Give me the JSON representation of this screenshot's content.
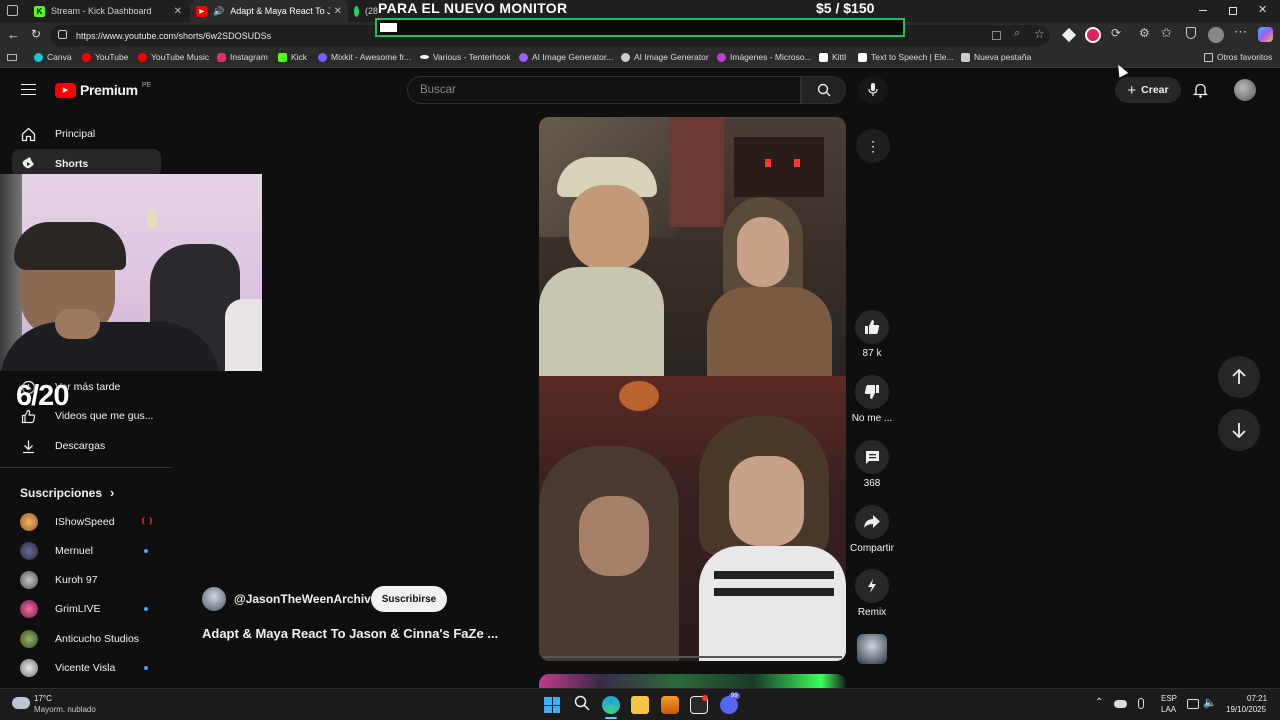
{
  "browser": {
    "tabs": [
      {
        "label": "Stream - Kick Dashboard",
        "icon": "kick-icon",
        "color": "#53fc18"
      },
      {
        "label": "Adapt & Maya React To Jaso",
        "icon": "youtube-icon",
        "color": "#ff0000"
      },
      {
        "label": "(28",
        "icon": "whatsapp-icon",
        "color": "#25d366"
      }
    ],
    "url": "https://www.youtube.com/shorts/6w2SDOSUDSs",
    "bookmarks": [
      {
        "label": "Canva",
        "color": "#20c4cb"
      },
      {
        "label": "YouTube",
        "color": "#ff0000"
      },
      {
        "label": "YouTube Music",
        "color": "#ff0000"
      },
      {
        "label": "Instagram",
        "color": "#e1306c"
      },
      {
        "label": "Kick",
        "color": "#53fc18"
      },
      {
        "label": "Mixkit - Awesome fr...",
        "color": "#7b5cff"
      },
      {
        "label": "Various - Tenterhook",
        "color": "#ffffff"
      },
      {
        "label": "AI Image Generator...",
        "color": "#a259ff"
      },
      {
        "label": "AI Image Generator",
        "color": "#cccccc"
      },
      {
        "label": "Imágenes - Microso...",
        "color": "#c23fd6"
      },
      {
        "label": "Kittl",
        "color": "#ffffff"
      },
      {
        "label": "Text to Speech | Ele...",
        "color": "#ffffff"
      },
      {
        "label": "Nueva pestaña",
        "color": "#cccccc"
      }
    ],
    "other_favorites": "Otros favoritos"
  },
  "overlay": {
    "title": "PARA EL NUEVO MONITOR",
    "amount": "$5  / $150",
    "progress": 0.0333,
    "counter": "6/20",
    "accent": "#1ec05a"
  },
  "youtube": {
    "logo": "Premium",
    "region": "PE",
    "search_placeholder": "Buscar",
    "create_label": "Crear",
    "sidebar": [
      {
        "label": "Principal",
        "icon": "home-icon"
      },
      {
        "label": "Shorts",
        "icon": "shorts-icon"
      },
      {
        "label": "Ver más tarde",
        "icon": "clock-icon"
      },
      {
        "label": "Videos que me gus...",
        "icon": "like-icon"
      },
      {
        "label": "Descargas",
        "icon": "download-icon"
      }
    ],
    "subscriptions_title": "Suscripciones",
    "subscriptions": [
      {
        "name": "IShowSpeed",
        "new": false,
        "live": true
      },
      {
        "name": "Mernuel",
        "new": true,
        "live": false
      },
      {
        "name": "Kuroh 97",
        "new": false,
        "live": false
      },
      {
        "name": "GrimLIVE",
        "new": true,
        "live": false
      },
      {
        "name": "Anticucho Studios",
        "new": false,
        "live": false
      },
      {
        "name": "Vicente Visla",
        "new": true,
        "live": false
      }
    ],
    "short": {
      "channel": "@JasonTheWeenArchive",
      "subscribe_label": "Suscribirse",
      "title": "Adapt & Maya React To Jason & Cinna's FaZe ...",
      "likes": "87 k",
      "dislike_label": "No me ...",
      "comments": "368",
      "share_label": "Compartir",
      "remix_label": "Remix"
    }
  },
  "taskbar": {
    "temperature": "17°C",
    "weather": "Mayorm. nublado",
    "lang_top": "ESP",
    "lang_bottom": "LAA",
    "time": "07:21",
    "date": "19/10/2025",
    "notification_badge": "99"
  }
}
